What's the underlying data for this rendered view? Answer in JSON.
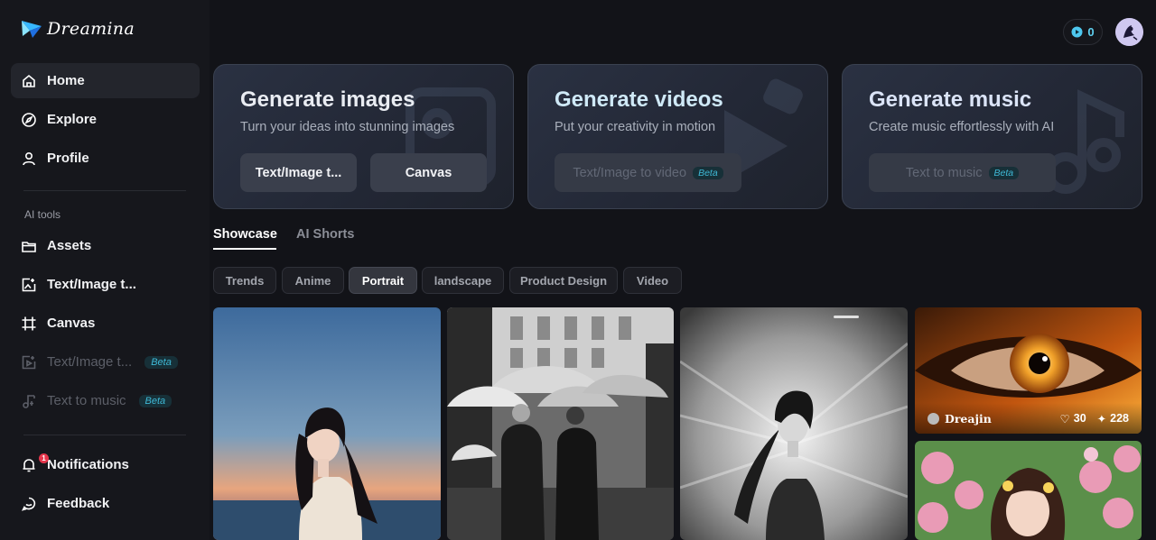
{
  "app": {
    "name": "Dreamina"
  },
  "sidebar": {
    "items": [
      {
        "label": "Home"
      },
      {
        "label": "Explore"
      },
      {
        "label": "Profile"
      }
    ],
    "section_label": "AI tools",
    "tools": [
      {
        "label": "Assets"
      },
      {
        "label": "Text/Image t..."
      },
      {
        "label": "Canvas"
      },
      {
        "label": "Text/Image t...",
        "badge": "Beta"
      },
      {
        "label": "Text to music",
        "badge": "Beta"
      }
    ],
    "bottom": [
      {
        "label": "Notifications",
        "count": "1"
      },
      {
        "label": "Feedback"
      }
    ]
  },
  "header": {
    "credits": "0"
  },
  "cards": [
    {
      "title": "Generate images",
      "subtitle": "Turn your ideas into stunning images",
      "buttons": [
        {
          "label": "Text/Image t..."
        },
        {
          "label": "Canvas"
        }
      ]
    },
    {
      "title": "Generate videos",
      "subtitle": "Put your creativity in motion",
      "buttons": [
        {
          "label": "Text/Image to video",
          "badge": "Beta"
        }
      ]
    },
    {
      "title": "Generate music",
      "subtitle": "Create music effortlessly with AI",
      "buttons": [
        {
          "label": "Text to music",
          "badge": "Beta"
        }
      ]
    }
  ],
  "tabs": [
    {
      "label": "Showcase"
    },
    {
      "label": "AI Shorts"
    }
  ],
  "filters": [
    {
      "label": "Trends"
    },
    {
      "label": "Anime"
    },
    {
      "label": "Portrait",
      "selected": true
    },
    {
      "label": "landscape"
    },
    {
      "label": "Product Design"
    },
    {
      "label": "Video"
    }
  ],
  "gallery": [
    {
      "author": "Dreajin",
      "likes": "30",
      "remixes": "228"
    }
  ],
  "colors": {
    "accent": "#3fb9d6",
    "background": "#121318",
    "sidebar": "#16171c",
    "card_border": "#3a4150"
  }
}
